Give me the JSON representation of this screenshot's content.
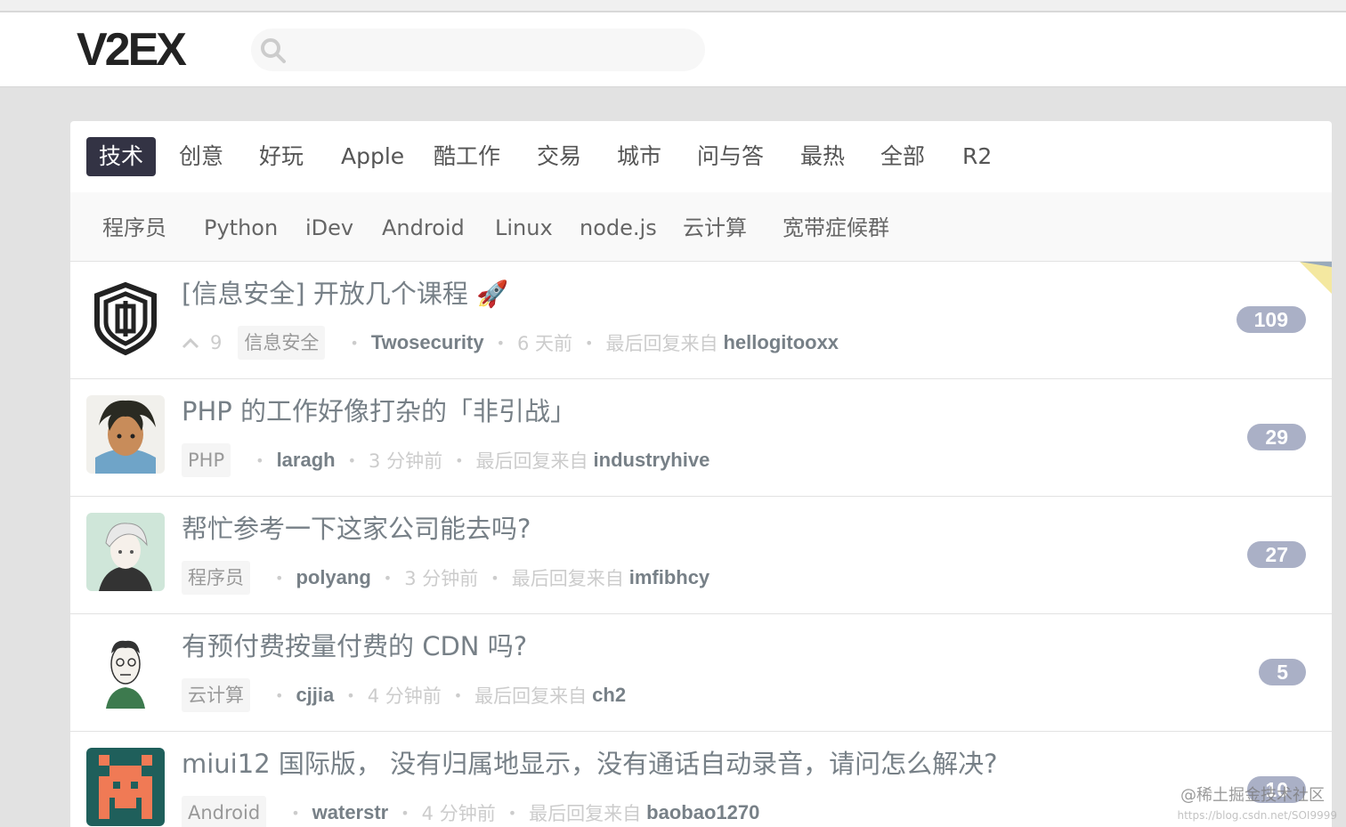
{
  "header": {
    "logo": "V2EX",
    "search_placeholder": ""
  },
  "tabs": [
    {
      "label": "技术",
      "active": true
    },
    {
      "label": "创意"
    },
    {
      "label": "好玩"
    },
    {
      "label": "Apple"
    },
    {
      "label": "酷工作"
    },
    {
      "label": "交易"
    },
    {
      "label": "城市"
    },
    {
      "label": "问与答"
    },
    {
      "label": "最热"
    },
    {
      "label": "全部"
    },
    {
      "label": "R2"
    }
  ],
  "subtabs": [
    "程序员",
    "Python",
    "iDev",
    "Android",
    "Linux",
    "node.js",
    "云计算",
    "宽带症候群"
  ],
  "topics": [
    {
      "title": "[信息安全] 开放几个课程 🚀",
      "votes": "9",
      "node": "信息安全",
      "author": "Twosecurity",
      "time": "6 天前",
      "last_reply_label": "最后回复来自",
      "last_reply_by": "hellogitooxx",
      "replies": "109",
      "avatar_icon": "shield-logo-icon"
    },
    {
      "title": "PHP 的工作好像打杂的「非引战」",
      "node": "PHP",
      "author": "laragh",
      "time": "3 分钟前",
      "last_reply_label": "最后回复来自",
      "last_reply_by": "industryhive",
      "replies": "29",
      "avatar_icon": "anime-avatar-icon"
    },
    {
      "title": "帮忙参考一下这家公司能去吗?",
      "node": "程序员",
      "author": "polyang",
      "time": "3 分钟前",
      "last_reply_label": "最后回复来自",
      "last_reply_by": "imfibhcy",
      "replies": "27",
      "avatar_icon": "sketch-avatar-icon"
    },
    {
      "title": "有预付费按量付费的 CDN 吗?",
      "node": "云计算",
      "author": "cjjia",
      "time": "4 分钟前",
      "last_reply_label": "最后回复来自",
      "last_reply_by": "ch2",
      "replies": "5",
      "avatar_icon": "cartoon-avatar-icon"
    },
    {
      "title": "miui12 国际版， 没有归属地显示，没有通话自动录音，请问怎么解决?",
      "node": "Android",
      "author": "waterstr",
      "time": "4 分钟前",
      "last_reply_label": "最后回复来自",
      "last_reply_by": "baobao1270",
      "replies": "10",
      "avatar_icon": "pixel-invader-avatar-icon"
    }
  ],
  "watermark": {
    "text": "@稀土掘金技术社区",
    "url": "https://blog.csdn.net/SOI9999"
  },
  "colors": {
    "tab_active_bg": "#334",
    "reply_count_bg": "#aab0c6",
    "corner_flag": "#f4e8a0"
  }
}
